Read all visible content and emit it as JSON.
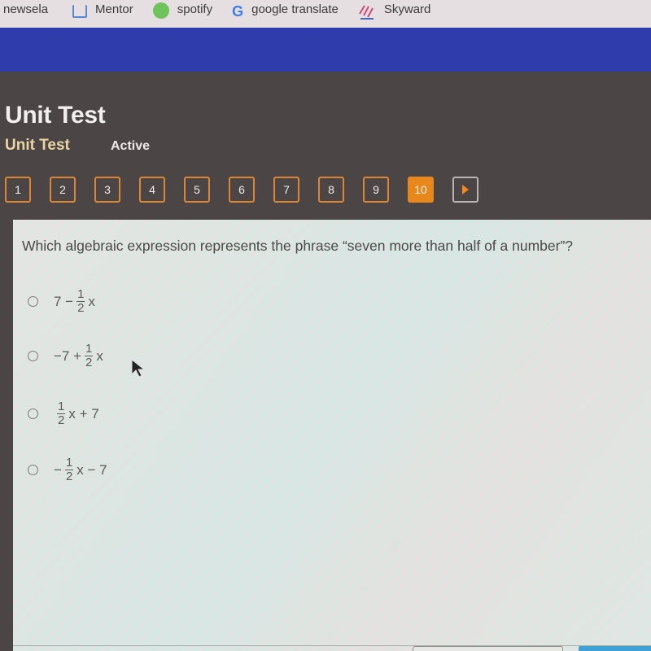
{
  "bookmarks": [
    {
      "label": "newsela",
      "icon": "none"
    },
    {
      "label": "Mentor",
      "icon": "mentor-icon"
    },
    {
      "label": "spotify",
      "icon": "spotify-icon"
    },
    {
      "label": "google translate",
      "icon": "google-icon"
    },
    {
      "label": "Skyward",
      "icon": "skyward-icon"
    }
  ],
  "header": {
    "title": "Unit Test",
    "subtitle": "Unit Test",
    "status": "Active"
  },
  "question_nav": {
    "items": [
      "1",
      "2",
      "3",
      "4",
      "5",
      "6",
      "7",
      "8",
      "9",
      "10"
    ],
    "active": "10",
    "next_icon": "play-arrow-icon"
  },
  "question": {
    "text": "Which algebraic expression represents the phrase “seven more than half of a number”?",
    "options": [
      {
        "id": "a",
        "parts": {
          "pre": "7 −",
          "num": "1",
          "den": "2",
          "post": "x"
        }
      },
      {
        "id": "b",
        "parts": {
          "pre": "−7 +",
          "num": "1",
          "den": "2",
          "post": "x"
        }
      },
      {
        "id": "c",
        "parts": {
          "pre": "",
          "num": "1",
          "den": "2",
          "post": "x + 7"
        }
      },
      {
        "id": "d",
        "parts": {
          "pre": "−",
          "num": "1",
          "den": "2",
          "post": "x − 7"
        }
      }
    ]
  },
  "colors": {
    "accent_orange": "#e8871b",
    "header_blue": "#2f3cab",
    "subtitle_gold": "#e8d5a2"
  }
}
